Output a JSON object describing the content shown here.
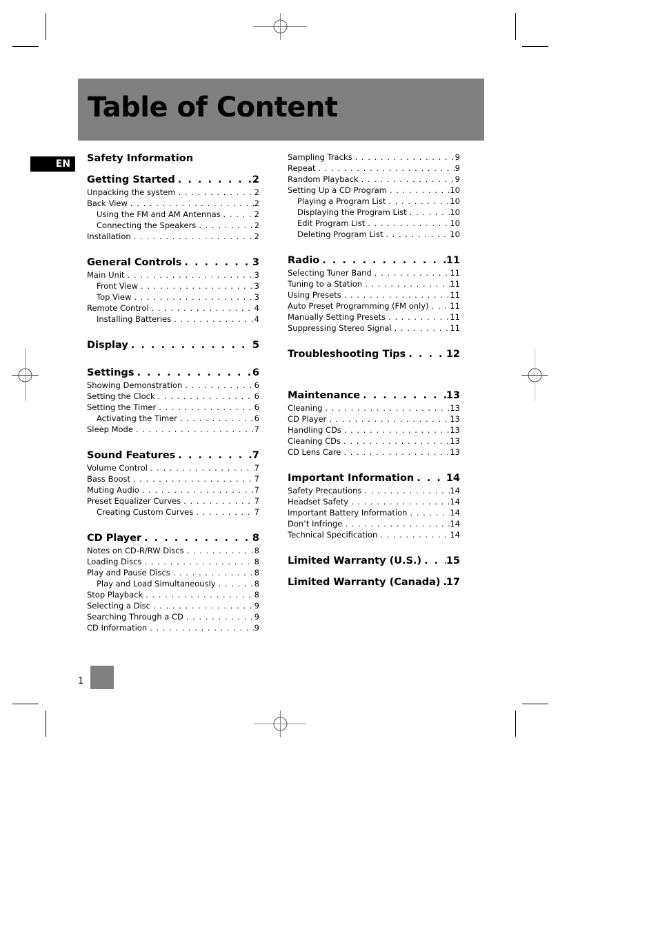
{
  "header": {
    "title": "Table of Content"
  },
  "language_tab": "EN",
  "footer": {
    "page_number": "1"
  },
  "left_column": {
    "safety": "Safety Information",
    "getting_started": {
      "title": "Getting Started",
      "page": "2",
      "items": [
        {
          "label": "Unpacking the system",
          "page": "2",
          "level": 1
        },
        {
          "label": "Back View",
          "page": "2",
          "level": 1
        },
        {
          "label": "Using the FM and AM Antennas",
          "page": "2",
          "level": 2
        },
        {
          "label": "Connecting the Speakers",
          "page": "2",
          "level": 2
        },
        {
          "label": "Installation",
          "page": "2",
          "level": 1
        }
      ]
    },
    "general_controls": {
      "title": "General Controls",
      "page": "3",
      "items": [
        {
          "label": "Main Unit",
          "page": "3",
          "level": 1
        },
        {
          "label": "Front View",
          "page": "3",
          "level": 2
        },
        {
          "label": "Top View",
          "page": "3",
          "level": 2
        },
        {
          "label": "Remote Control",
          "page": "4",
          "level": 1
        },
        {
          "label": "Installing Batteries",
          "page": "4",
          "level": 2
        }
      ]
    },
    "display": {
      "title": "Display",
      "page": "5"
    },
    "settings": {
      "title": "Settings",
      "page": "6",
      "items": [
        {
          "label": "Showing Demonstration",
          "page": "6",
          "level": 1
        },
        {
          "label": "Setting the Clock",
          "page": "6",
          "level": 1
        },
        {
          "label": "Setting the Timer",
          "page": "6",
          "level": 1
        },
        {
          "label": "Activating the Timer",
          "page": "6",
          "level": 2
        },
        {
          "label": "Sleep Mode",
          "page": "7",
          "level": 1
        }
      ]
    },
    "sound_features": {
      "title": "Sound Features",
      "page": "7",
      "items": [
        {
          "label": "Volume Control",
          "page": "7",
          "level": 1
        },
        {
          "label": "Bass Boost",
          "page": "7",
          "level": 1
        },
        {
          "label": "Muting Audio",
          "page": "7",
          "level": 1
        },
        {
          "label": "Preset Equalizer Curves",
          "page": "7",
          "level": 1
        },
        {
          "label": "Creating Custom Curves",
          "page": "7",
          "level": 2
        }
      ]
    },
    "cd_player": {
      "title": "CD Player",
      "page": "8",
      "items": [
        {
          "label": "Notes on CD-R/RW Discs",
          "page": "8",
          "level": 1
        },
        {
          "label": "Loading Discs",
          "page": "8",
          "level": 1
        },
        {
          "label": "Play and Pause Discs",
          "page": "8",
          "level": 1
        },
        {
          "label": "Play and Load Simultaneously",
          "page": "8",
          "level": 2
        },
        {
          "label": "Stop Playback",
          "page": "8",
          "level": 1
        },
        {
          "label": "Selecting a Disc",
          "page": "9",
          "level": 1
        },
        {
          "label": "Searching Through a CD",
          "page": "9",
          "level": 1
        },
        {
          "label": "CD Information",
          "page": "9",
          "level": 1
        }
      ]
    }
  },
  "right_column": {
    "cd_continued": {
      "items": [
        {
          "label": "Sampling Tracks",
          "page": "9",
          "level": 1
        },
        {
          "label": "Repeat",
          "page": "9",
          "level": 1
        },
        {
          "label": "Random Playback",
          "page": "9",
          "level": 1
        },
        {
          "label": "Setting Up a CD Program",
          "page": "10",
          "level": 1
        },
        {
          "label": "Playing a Program List",
          "page": "10",
          "level": 2
        },
        {
          "label": "Displaying the Program List",
          "page": "10",
          "level": 2
        },
        {
          "label": "Edit Program List",
          "page": "10",
          "level": 2
        },
        {
          "label": "Deleting Program List",
          "page": "10",
          "level": 2
        }
      ]
    },
    "radio": {
      "title": "Radio",
      "page": "11",
      "items": [
        {
          "label": "Selecting Tuner Band",
          "page": "11",
          "level": 1
        },
        {
          "label": "Tuning to a Station",
          "page": "11",
          "level": 1
        },
        {
          "label": "Using Presets",
          "page": "11",
          "level": 1
        },
        {
          "label": "Auto Preset Programming (FM only)",
          "page": "11",
          "level": 1
        },
        {
          "label": "Manually Setting Presets",
          "page": "11",
          "level": 1
        },
        {
          "label": "Suppressing Stereo Signal",
          "page": "11",
          "level": 1
        }
      ]
    },
    "troubleshooting": {
      "title": "Troubleshooting Tips",
      "page": "12"
    },
    "maintenance": {
      "title": "Maintenance",
      "page": "13",
      "items": [
        {
          "label": "Cleaning",
          "page": "13",
          "level": 1
        },
        {
          "label": "CD Player",
          "page": "13",
          "level": 1
        },
        {
          "label": "Handling CDs",
          "page": "13",
          "level": 1
        },
        {
          "label": "Cleaning CDs",
          "page": "13",
          "level": 1
        },
        {
          "label": "CD Lens Care",
          "page": "13",
          "level": 1
        }
      ]
    },
    "important_info": {
      "title": "Important Information",
      "page": "14",
      "items": [
        {
          "label": "Safety Precautions",
          "page": "14",
          "level": 1
        },
        {
          "label": "Headset Safety",
          "page": "14",
          "level": 1
        },
        {
          "label": "Important Battery Information",
          "page": "14",
          "level": 1
        },
        {
          "label": "Don’t Infringe",
          "page": "14",
          "level": 1
        },
        {
          "label": "Technical Specification",
          "page": "14",
          "level": 1
        }
      ]
    },
    "warranty_us": {
      "title": "Limited Warranty (U.S.)",
      "page": "15"
    },
    "warranty_canada": {
      "title": "Limited Warranty (Canada)",
      "page": "17"
    }
  }
}
